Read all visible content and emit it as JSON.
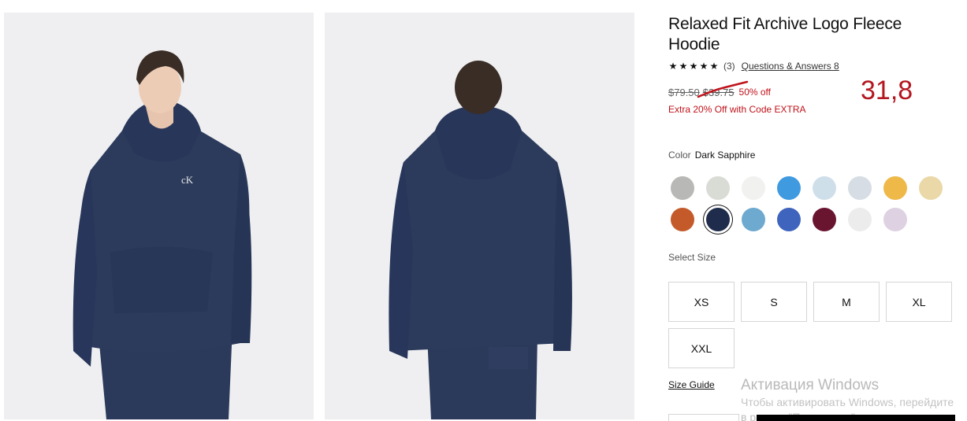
{
  "product": {
    "title": "Relaxed Fit Archive Logo Fleece Hoodie",
    "stars": [
      "★",
      "★",
      "★",
      "★",
      "★"
    ],
    "rating_count": "(3)",
    "qa_link": "Questions & Answers 8",
    "price_original": "$79.50",
    "price_sale": "$39.75",
    "discount": "50% off",
    "promo": "Extra 20% Off with Code EXTRA"
  },
  "annotation": {
    "handwritten_value": "31,8"
  },
  "color": {
    "label": "Color",
    "selected": "Dark Sapphire",
    "swatches": [
      {
        "name": "heather-grey",
        "hex": "#b8b8b6"
      },
      {
        "name": "light-grey",
        "hex": "#d9dbd5"
      },
      {
        "name": "white",
        "hex": "#f1f1ef"
      },
      {
        "name": "blue",
        "hex": "#3f9ae0"
      },
      {
        "name": "light-blue",
        "hex": "#cfdfe9"
      },
      {
        "name": "pale-grey-blue",
        "hex": "#d6dde4"
      },
      {
        "name": "yellow",
        "hex": "#efb94a"
      },
      {
        "name": "cream",
        "hex": "#ead8a8"
      },
      {
        "name": "burnt-orange",
        "hex": "#c45a2a"
      },
      {
        "name": "dark-sapphire",
        "hex": "#1f2c4c"
      },
      {
        "name": "sky-blue",
        "hex": "#6ea9d0"
      },
      {
        "name": "royal-blue",
        "hex": "#3f64bd"
      },
      {
        "name": "burgundy",
        "hex": "#6a1530"
      },
      {
        "name": "off-white",
        "hex": "#ececec"
      },
      {
        "name": "lavender",
        "hex": "#ddd1e2"
      }
    ]
  },
  "size": {
    "label": "Select Size",
    "options": [
      "XS",
      "S",
      "M",
      "XL",
      "XXL"
    ],
    "guide": "Size Guide"
  },
  "windows_watermark": {
    "title": "Активация Windows",
    "line1": "Чтобы активировать Windows, перейдите",
    "line2": "в раздел \"Параметры\"."
  },
  "colors": {
    "hoodie": "#2c3b5c",
    "sale_red": "#c0121a"
  }
}
